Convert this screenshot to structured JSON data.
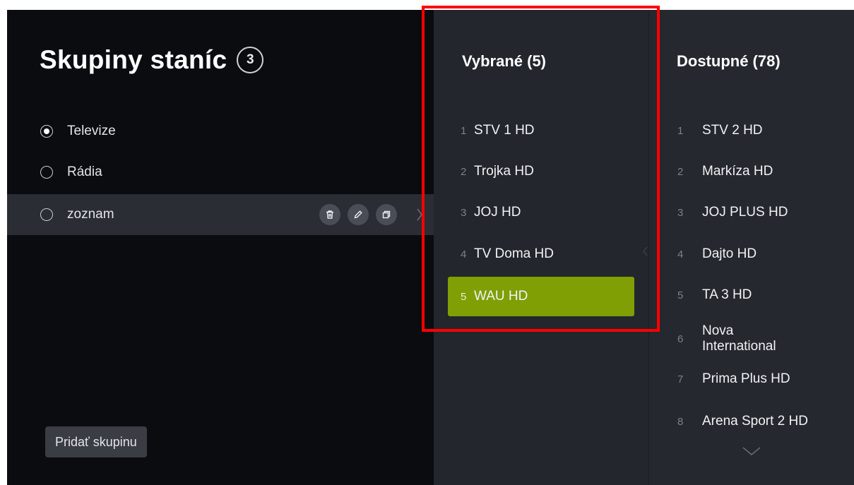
{
  "header": {
    "title": "Skupiny staníc",
    "count": "3"
  },
  "groups": [
    {
      "label": "Televize",
      "checked": true
    },
    {
      "label": "Rádia",
      "checked": false
    },
    {
      "label": "zoznam",
      "checked": false
    }
  ],
  "group_actions": [
    "trash-icon",
    "pencil-icon",
    "duplicate-icon"
  ],
  "add_group_label": "Pridať skupinu",
  "selected_column": {
    "title": "Vybrané (5)",
    "channels": [
      {
        "num": "1",
        "name": "STV 1 HD"
      },
      {
        "num": "2",
        "name": "Trojka HD"
      },
      {
        "num": "3",
        "name": "JOJ HD"
      },
      {
        "num": "4",
        "name": "TV Doma HD"
      },
      {
        "num": "5",
        "name": "WAU HD"
      }
    ]
  },
  "available_column": {
    "title": "Dostupné (78)",
    "channels": [
      {
        "num": "1",
        "name": "STV 2 HD"
      },
      {
        "num": "2",
        "name": "Markíza HD"
      },
      {
        "num": "3",
        "name": "JOJ PLUS HD"
      },
      {
        "num": "4",
        "name": "Dajto HD"
      },
      {
        "num": "5",
        "name": "TA 3 HD"
      },
      {
        "num": "6",
        "name": "Nova International"
      },
      {
        "num": "7",
        "name": "Prima Plus HD"
      },
      {
        "num": "8",
        "name": "Arena Sport 2 HD"
      }
    ]
  },
  "colors": {
    "background": "#0b0c10",
    "panel": "#23262c",
    "accent_green": "#7f9f05",
    "highlight_red": "#ff0000"
  }
}
